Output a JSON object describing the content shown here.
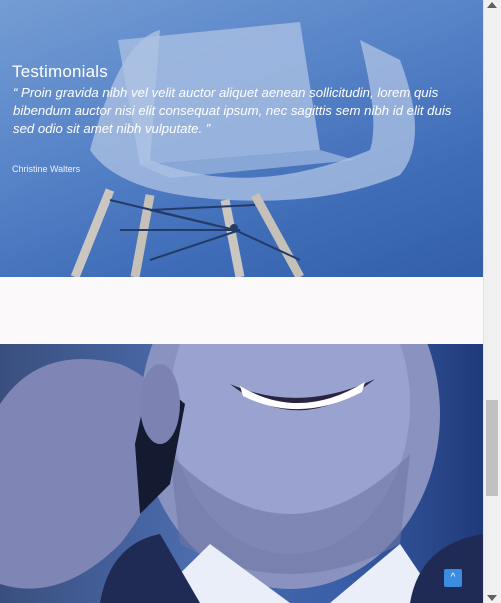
{
  "testimonial": {
    "title": "Testimonials",
    "quote": "“ Proin gravida nibh vel velit auctor aliquet aenean sollicitudin, lorem quis bibendum auctor nisi elit consequat ipsum, nec sagittis sem nibh id elit duis sed odio sit amet nibh vulputate. ”",
    "author": "Christine Walters"
  },
  "back_to_top": {
    "icon": "chevron-up-icon",
    "glyph": "^"
  },
  "colors": {
    "hero_blue": "#5f8bcd",
    "accent": "#3c8de0",
    "background": "#fbf9f9"
  }
}
